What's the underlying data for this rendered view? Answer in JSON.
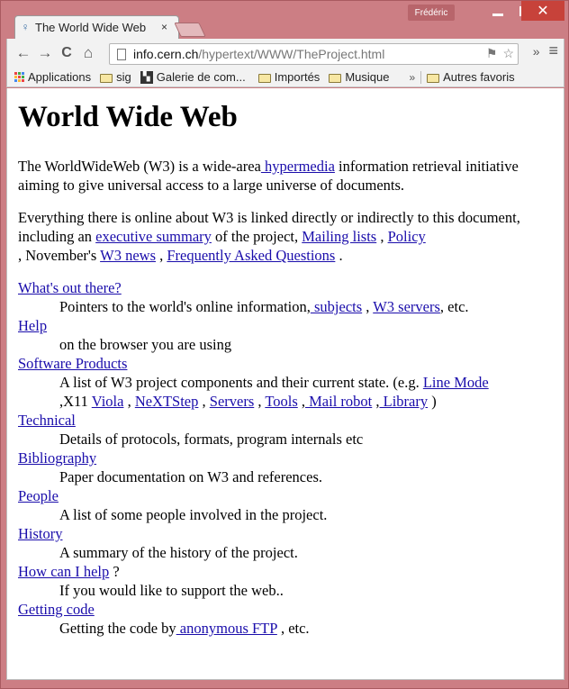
{
  "browser": {
    "tab_title": "The World Wide Web",
    "tab_close": "×",
    "profile_name": "Frédéric",
    "url_host": "info.cern.ch",
    "url_path": "/hypertext/WWW/TheProject.html",
    "icons": {
      "back": "←",
      "forward": "→",
      "reload": "C",
      "home": "⌂",
      "star": "☆",
      "translate": "⚑",
      "extensions": "»",
      "menu": "≡",
      "close": "✕"
    }
  },
  "bookmarks": {
    "items": [
      "Applications",
      "sig",
      "Galerie de com...",
      "Importés",
      "Musique"
    ],
    "more": "»",
    "other": "Autres favoris",
    "apps_colors": [
      "#e44",
      "#4a4",
      "#48e",
      "#fb3",
      "#e44",
      "#4a4",
      "#48e",
      "#fb3",
      "#e44"
    ]
  },
  "page": {
    "title": "World Wide Web",
    "intro": {
      "t1": "The WorldWideWeb (W3) is a wide-area",
      "link_hypermedia": " hypermedia",
      "t2": " information retrieval initiative aiming to give universal access to a large universe of documents."
    },
    "para2": {
      "t1": "Everything there is online about W3 is linked directly or indirectly to this document, including an ",
      "link_exec": "executive summary",
      "t2": " of the project, ",
      "link_mailing": "Mailing lists",
      "t3": " , ",
      "link_policy": "Policy",
      "t4": " , November's ",
      "link_news": "W3 news",
      "t5": " , ",
      "link_faq": "Frequently Asked Questions",
      "t6": " ."
    },
    "entries": {
      "whats": {
        "term": "What's out there?",
        "d1": "Pointers to the world's online information,",
        "l1": " subjects",
        "d2": " , ",
        "l2": "W3 servers",
        "d3": ", etc."
      },
      "help": {
        "term": "Help",
        "desc": "on the browser you are using"
      },
      "software": {
        "term": "Software Products",
        "d1": "A list of W3 project components and their current state. (e.g. ",
        "l_line": "Line Mode",
        "d2": " ,X11 ",
        "l_viola": "Viola",
        "d3": " , ",
        "l_next": "NeXTStep",
        "d4": " , ",
        "l_servers": "Servers",
        "d5": " , ",
        "l_tools": "Tools",
        "d6": " ,",
        "l_mail": " Mail robot",
        "d7": " ,",
        "l_lib": " Library",
        "d8": " )"
      },
      "technical": {
        "term": "Technical",
        "desc": "Details of protocols, formats, program internals etc"
      },
      "bibliography": {
        "term": "Bibliography",
        "desc": "Paper documentation on W3 and references."
      },
      "people": {
        "term": "People",
        "desc": "A list of some people involved in the project."
      },
      "history": {
        "term": "History",
        "desc": "A summary of the history of the project."
      },
      "howhelp": {
        "term": "How can I help",
        "suffix": " ?",
        "desc": "If you would like to support the web.."
      },
      "getting": {
        "term": "Getting code",
        "d1": "Getting the code by",
        "l_ftp": " anonymous FTP",
        "d2": " , etc."
      }
    }
  }
}
